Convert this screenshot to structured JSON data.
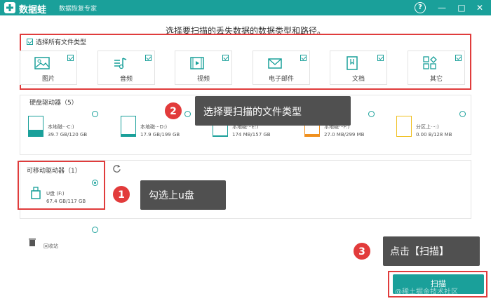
{
  "titlebar": {
    "app_name": "数据蛙",
    "subtitle": "数据恢复专家",
    "help_icon": "?",
    "min_icon": "—",
    "max_icon": "□",
    "close_icon": "✕"
  },
  "heading": "选择要扫描的丢失数据的数据类型和路径。",
  "file_types": {
    "select_all_label": "选择所有文件类型",
    "select_all_checked": true,
    "items": [
      {
        "label": "图片",
        "icon": "image-icon",
        "checked": true
      },
      {
        "label": "音频",
        "icon": "music-icon",
        "checked": true
      },
      {
        "label": "视频",
        "icon": "video-icon",
        "checked": true
      },
      {
        "label": "电子邮件",
        "icon": "email-icon",
        "checked": true
      },
      {
        "label": "文档",
        "icon": "document-icon",
        "checked": true
      },
      {
        "label": "其它",
        "icon": "other-icon",
        "checked": true
      }
    ]
  },
  "callouts": {
    "step1": {
      "number": "1",
      "text": "勾选上u盘"
    },
    "step2": {
      "number": "2",
      "text": "选择要扫描的文件类型"
    },
    "step3": {
      "number": "3",
      "text": "点击【扫描】"
    }
  },
  "hard_drives": {
    "title": "硬盘驱动器（5）",
    "drives": [
      {
        "name": "本地磁···C:)",
        "size": "39.7 GB/120 GB",
        "fill_fraction": 0.33,
        "fill_color": "#1aa09a",
        "selected": false
      },
      {
        "name": "本地磁···D:)",
        "size": "17.9 GB/199 GB",
        "fill_fraction": 0.09,
        "fill_color": "#1aa09a",
        "selected": false
      },
      {
        "name": "本地磁···E:)",
        "size": "174 MB/157 GB",
        "fill_fraction": 0.02,
        "fill_color": "#1aa09a",
        "selected": false
      },
      {
        "name": "本地磁···F:)",
        "size": "27.0 MB/299 MB",
        "fill_fraction": 0.09,
        "fill_color": "#f0901e",
        "selected": false
      },
      {
        "name": "分区上···:)",
        "size": "0.00  B/128 MB",
        "fill_fraction": 0.0,
        "fill_color": "#f0c020",
        "selected": false
      }
    ]
  },
  "removable": {
    "title": "可移动驱动器（1）",
    "refresh_icon": "refresh-icon",
    "drive": {
      "name": "U盘 (F:)",
      "size": "67.4 GB/117 GB",
      "selected": true
    }
  },
  "recycle_bin": {
    "label": "回收站",
    "selected": false
  },
  "scan_button": "扫描",
  "watermark": "@稀土掘金技术社区"
}
